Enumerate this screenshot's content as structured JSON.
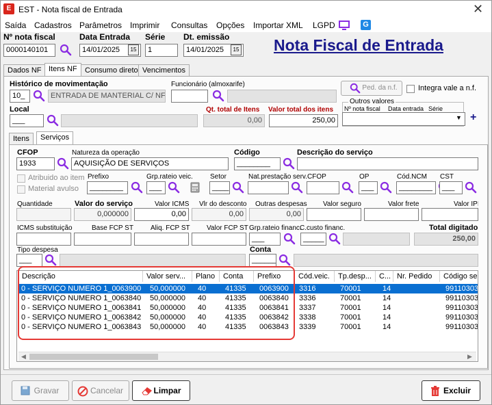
{
  "window": {
    "title": "EST - Nota fiscal de Entrada",
    "close": "✕"
  },
  "menu": [
    "Saída",
    "Cadastros",
    "Parâmetros",
    "Imprimir",
    "Consultas",
    "Opções",
    "Importar XML",
    "LGPD"
  ],
  "header": {
    "nota_label": "Nº nota fiscal",
    "nota_value": "0000140101",
    "data_entrada_label": "Data Entrada",
    "data_entrada_value": "14/01/2025",
    "serie_label": "Série",
    "serie_value": "1",
    "emissao_label": "Dt. emissão",
    "emissao_value": "14/01/2025",
    "big_title": "Nota Fiscal de Entrada",
    "cal": "15"
  },
  "tabs": [
    "Dados NF",
    "Itens NF",
    "Consumo direto",
    "Vencimentos"
  ],
  "itens": {
    "historico_label": "Histórico de movimentação",
    "historico_code": "10_",
    "historico_desc": "ENTRADA DE MANTERIAL C/ NF",
    "funcionario_label": "Funcionário (almoxarife)",
    "ped_button": "Ped. da n.f.",
    "integra_label": "Integra vale a n.f.",
    "local_label": "Local",
    "local_code": "___",
    "qt_total_label": "Qt. total de Itens",
    "qt_total_value": "0,00",
    "valor_total_label": "Valor total dos itens",
    "valor_total_value": "250,00",
    "outros_label": "Outros valores",
    "outros_cols": [
      "Nº nota fiscal",
      "Data entrada",
      "Série"
    ],
    "plus": "+"
  },
  "subtabs": [
    "Itens",
    "Serviços"
  ],
  "servicos": {
    "cfop_label": "CFOP",
    "cfop_value": "1933",
    "natureza_label": "Natureza da operação",
    "natureza_value": "AQUISIÇÃO DE SERVIÇOS",
    "codigo_label": "Código",
    "codigo_value": "________",
    "descricao_label": "Descrição do serviço",
    "atribuido_label": "Atribuido ao item",
    "material_label": "Material avulso",
    "prefixo_label": "Prefixo",
    "prefixo_value": "________",
    "grp_rateio_label": "Grp.rateio veic.",
    "grp_rateio_value": "___",
    "setor_label": "Setor",
    "setor_value": "____",
    "nat_prest_label": "Nat.prestação serv.",
    "cfop2_label": "CFOP",
    "op_label": "OP",
    "op_value": "___",
    "ncm_label": "Cód.NCM",
    "ncm_value": "________",
    "cst_label": "CST",
    "cst_value": "___",
    "quantidade_label": "Quantidade",
    "valor_servico_label": "Valor do serviço",
    "valor_servico_value": "0,000000",
    "valor_icms_label": "Valor ICMS",
    "valor_icms_value": "0,00",
    "vlr_desconto_label": "Vlr do desconto",
    "vlr_desconto_value": "0,00",
    "outras_desp_label": "Outras despesas",
    "outras_desp_value": "0,00",
    "valor_seguro_label": "Valor seguro",
    "valor_frete_label": "Valor frete",
    "valor_ipi_label": "Valor IPI",
    "icms_sub_label": "ICMS substituição",
    "base_fcp_label": "Base FCP ST",
    "aliq_fcp_label": "Aliq. FCP ST",
    "valor_fcp_label": "Valor FCP ST",
    "grp_fin_label": "Grp.rateio financ.",
    "grp_fin_value": "___",
    "custo_fin_label": "C.custo financ.",
    "custo_fin_value": "_____",
    "total_digitado_label": "Total digitado",
    "total_digitado_value": "250,00",
    "tipo_despesa_label": "Tipo despesa",
    "tipo_despesa_value": "___",
    "conta_label": "Conta",
    "conta_value": "______"
  },
  "grid": {
    "columns": [
      "Descrição",
      "Valor serv...",
      "Plano",
      "Conta",
      "Prefixo",
      "Cód.veic.",
      "Tp.desp...",
      "C...",
      "Nr. Pedido",
      "Código ser"
    ],
    "rows": [
      [
        "0 - SERVIÇO NUMERO 1_0063900",
        "50,000000",
        "40",
        "41335",
        "0063900",
        "3316",
        "70001",
        "14",
        "",
        "99110303"
      ],
      [
        "0 - SERVIÇO NUMERO 1_0063840",
        "50,000000",
        "40",
        "41335",
        "0063840",
        "3336",
        "70001",
        "14",
        "",
        "99110303"
      ],
      [
        "0 - SERVIÇO NUMERO 1_0063841",
        "50,000000",
        "40",
        "41335",
        "0063841",
        "3337",
        "70001",
        "14",
        "",
        "99110303"
      ],
      [
        "0 - SERVIÇO NUMERO 1_0063842",
        "50,000000",
        "40",
        "41335",
        "0063842",
        "3338",
        "70001",
        "14",
        "",
        "99110303"
      ],
      [
        "0 - SERVIÇO NUMERO 1_0063843",
        "50,000000",
        "40",
        "41335",
        "0063843",
        "3339",
        "70001",
        "14",
        "",
        "99110303"
      ]
    ]
  },
  "buttons": {
    "gravar": "Gravar",
    "cancelar": "Cancelar",
    "limpar": "Limpar",
    "excluir": "Excluir"
  },
  "colors": {
    "accent": "#0a6fd1",
    "red": "#d9261c",
    "purple": "#8a2be2",
    "title_blue": "#1a1a8c"
  }
}
